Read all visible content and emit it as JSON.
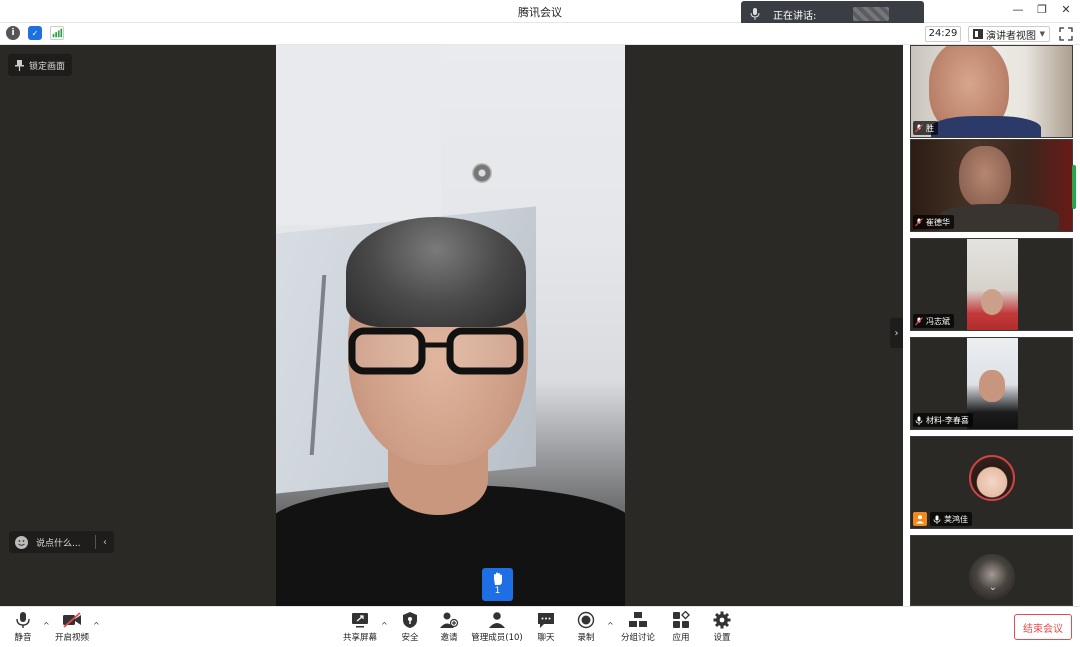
{
  "window": {
    "title": "腾讯会议"
  },
  "speaking": {
    "label": "正在讲话:"
  },
  "toolbar_top": {
    "timer": "24:29",
    "view_mode": "演讲者视图"
  },
  "stage": {
    "pin_label": "锁定画面",
    "chat_placeholder": "说点什么...",
    "raise_hand_count": "1"
  },
  "participants": [
    {
      "name": "胜",
      "mic": "muted"
    },
    {
      "name": "崔德华",
      "mic": "muted"
    },
    {
      "name": "冯志斌",
      "mic": "muted"
    },
    {
      "name": "材料-李春喜",
      "mic": "on"
    },
    {
      "name": "荚鸿佳",
      "mic": "on"
    },
    {
      "name": "",
      "mic": ""
    }
  ],
  "bottombar": {
    "mute": "静音",
    "video": "开启视频",
    "share": "共享屏幕",
    "security": "安全",
    "invite": "邀请",
    "members": "管理成员(10)",
    "chat": "聊天",
    "record": "录制",
    "breakout": "分组讨论",
    "apps": "应用",
    "settings": "设置",
    "end": "结束会议"
  },
  "colors": {
    "accent": "#1e6fe3",
    "end_red": "#e84b4b",
    "bg_dark": "#2b2926"
  }
}
